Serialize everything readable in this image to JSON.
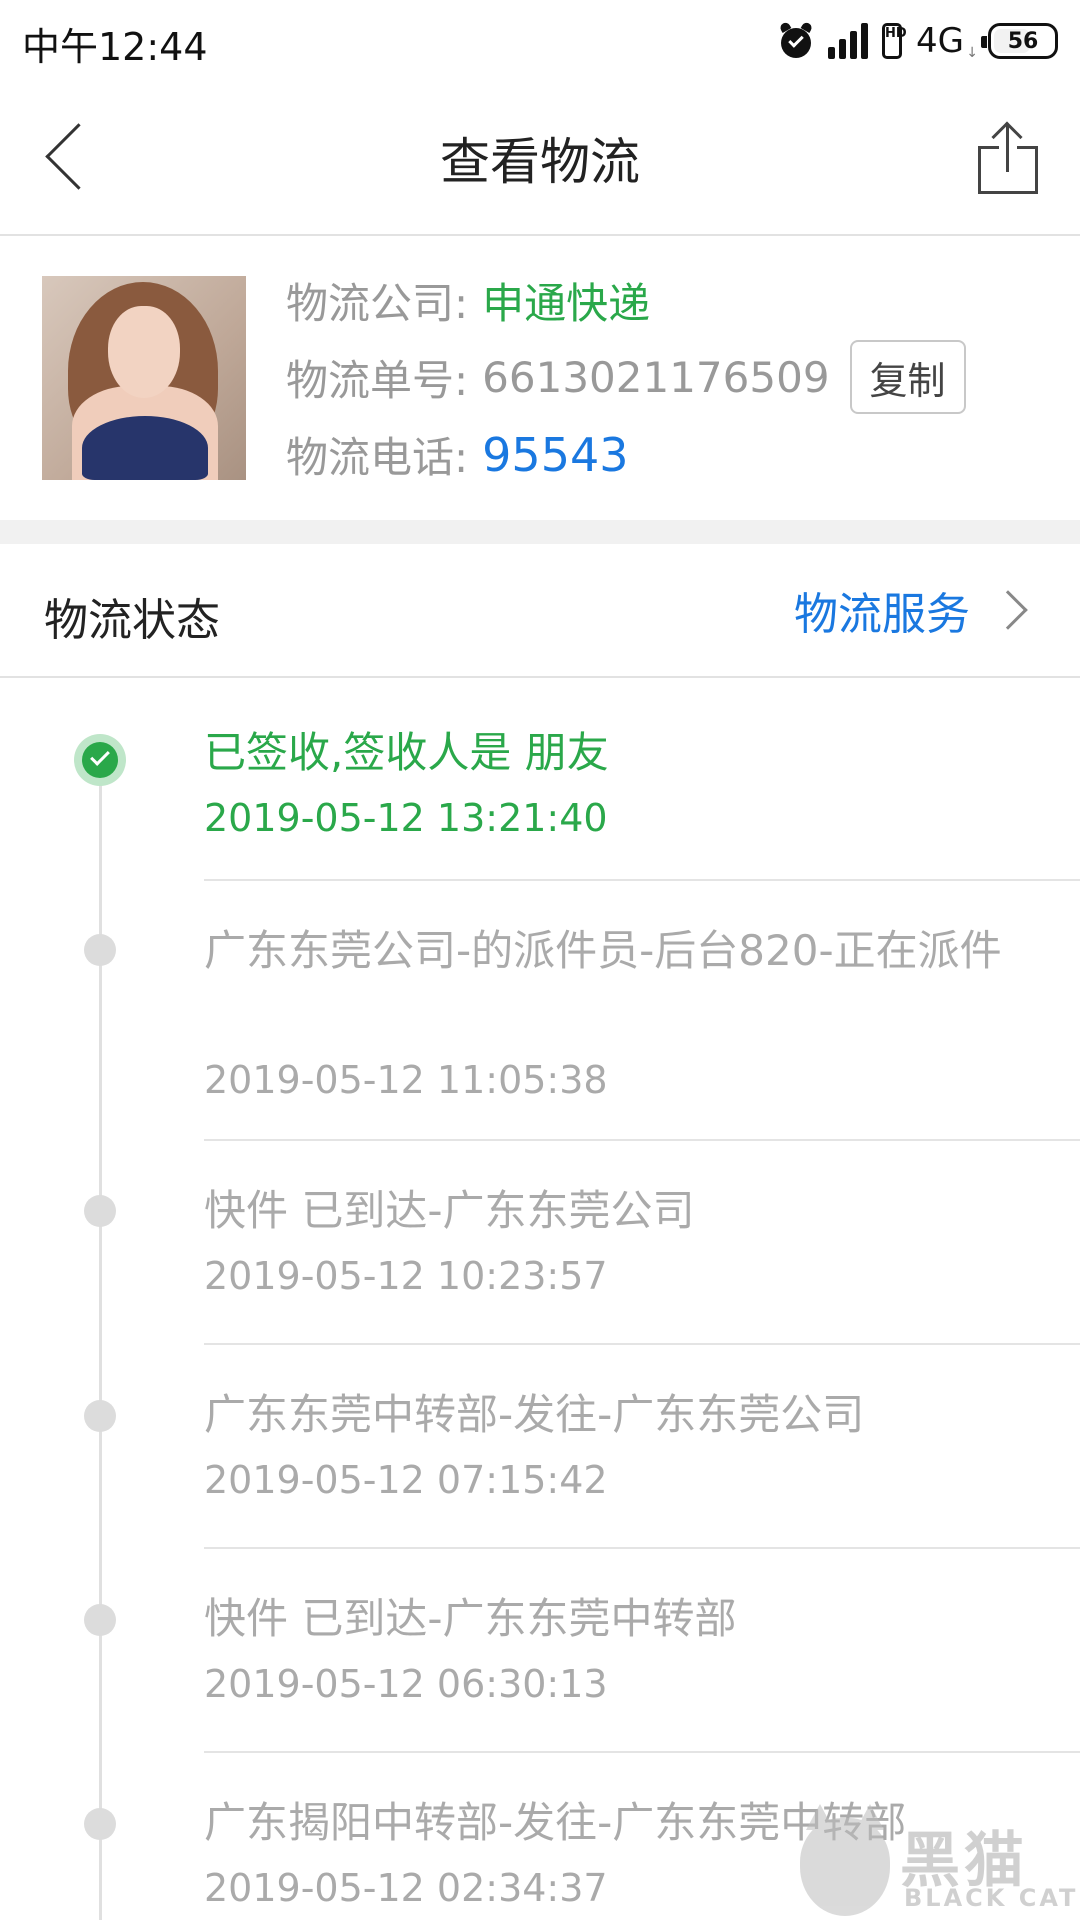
{
  "status_bar": {
    "time": "中午12:44",
    "network": "4G",
    "hd_badge": "HD",
    "battery": "56",
    "icons": [
      "alarm-icon",
      "signal-icon",
      "hd-icon",
      "battery-icon"
    ]
  },
  "nav": {
    "title": "查看物流",
    "back_icon": "chevron-left-icon",
    "share_icon": "share-icon"
  },
  "logistics": {
    "company_label": "物流公司:",
    "company_value": "申通快递",
    "number_label": "物流单号:",
    "number_value": "6613021176509",
    "copy_button": "复制",
    "phone_label": "物流电话:",
    "phone_value": "95543"
  },
  "status_section": {
    "title": "物流状态",
    "service_link": "物流服务"
  },
  "events": [
    {
      "description": "已签收,签收人是 朋友",
      "time": "2019-05-12 13:21:40",
      "current": true
    },
    {
      "description": "广东东莞公司-的派件员-后台820-正在派件",
      "time": "2019-05-12 11:05:38",
      "current": false
    },
    {
      "description": "快件 已到达-广东东莞公司",
      "time": "2019-05-12 10:23:57",
      "current": false
    },
    {
      "description": "广东东莞中转部-发往-广东东莞公司",
      "time": "2019-05-12 07:15:42",
      "current": false
    },
    {
      "description": "快件 已到达-广东东莞中转部",
      "time": "2019-05-12 06:30:13",
      "current": false
    },
    {
      "description": "广东揭阳中转部-发往-广东东莞中转部",
      "time": "2019-05-12 02:34:37",
      "current": false
    }
  ],
  "colors": {
    "accent_green": "#2aa84a",
    "link_blue": "#1a78e0",
    "muted_text": "#aaaaaa"
  },
  "watermark": {
    "main": "黑猫",
    "sub": "BLACK CAT"
  }
}
